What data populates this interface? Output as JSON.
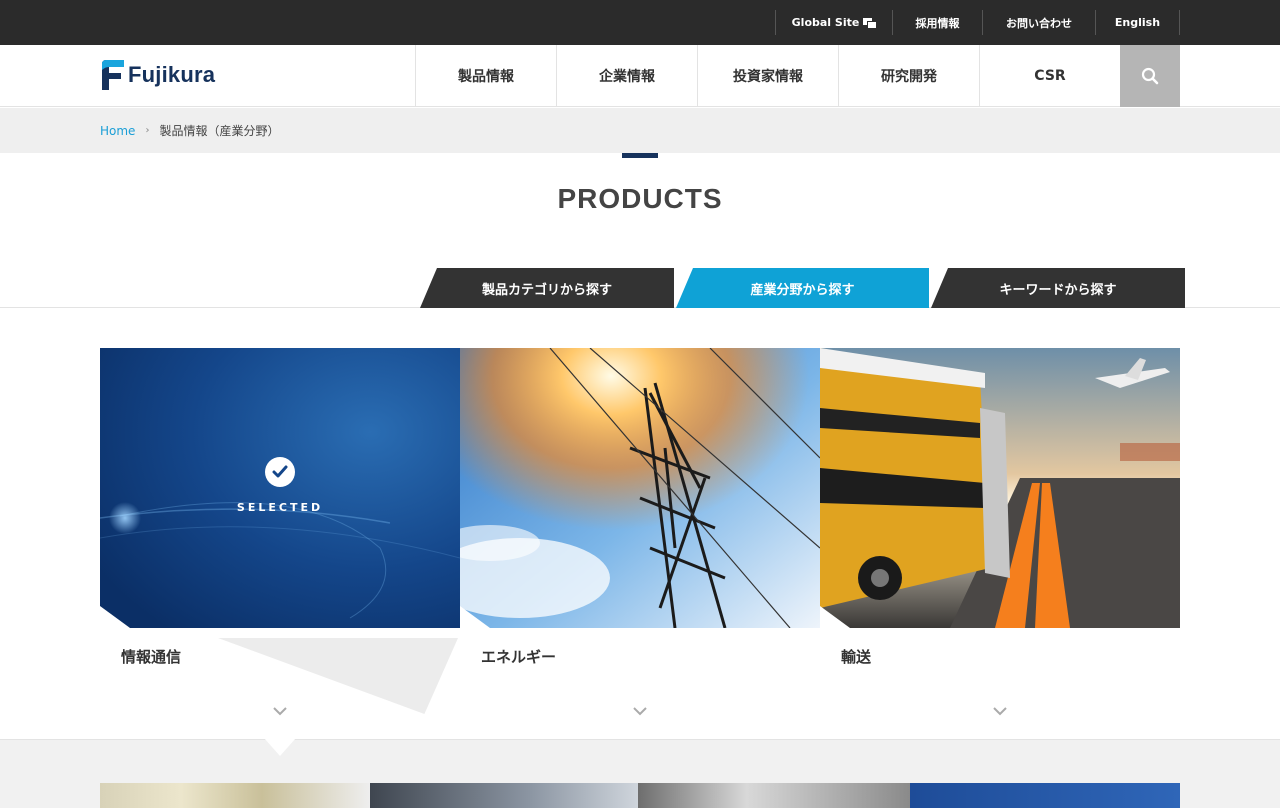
{
  "topbar": {
    "global_site": "Global Site",
    "recruit": "採用情報",
    "contact": "お問い合わせ",
    "english": "English"
  },
  "logo": {
    "text": "Fujikura"
  },
  "gnav": {
    "items": [
      "製品情報",
      "企業情報",
      "投資家情報",
      "研究開発",
      "CSR"
    ]
  },
  "breadcrumb": {
    "home": "Home",
    "separator": "›",
    "current": "製品情報（産業分野）"
  },
  "page": {
    "title": "PRODUCTS"
  },
  "tabs": [
    {
      "label": "製品カテゴリから探す"
    },
    {
      "label": "産業分野から探す",
      "active": true
    },
    {
      "label": "キーワードから探す"
    }
  ],
  "cards": [
    {
      "label": "情報通信",
      "selected": true,
      "selected_text": "SELECTED"
    },
    {
      "label": "エネルギー"
    },
    {
      "label": "輸送"
    }
  ],
  "colors": {
    "accent": "#0fa2d6",
    "brand_navy": "#16325c",
    "topbar": "#2b2b2b"
  }
}
